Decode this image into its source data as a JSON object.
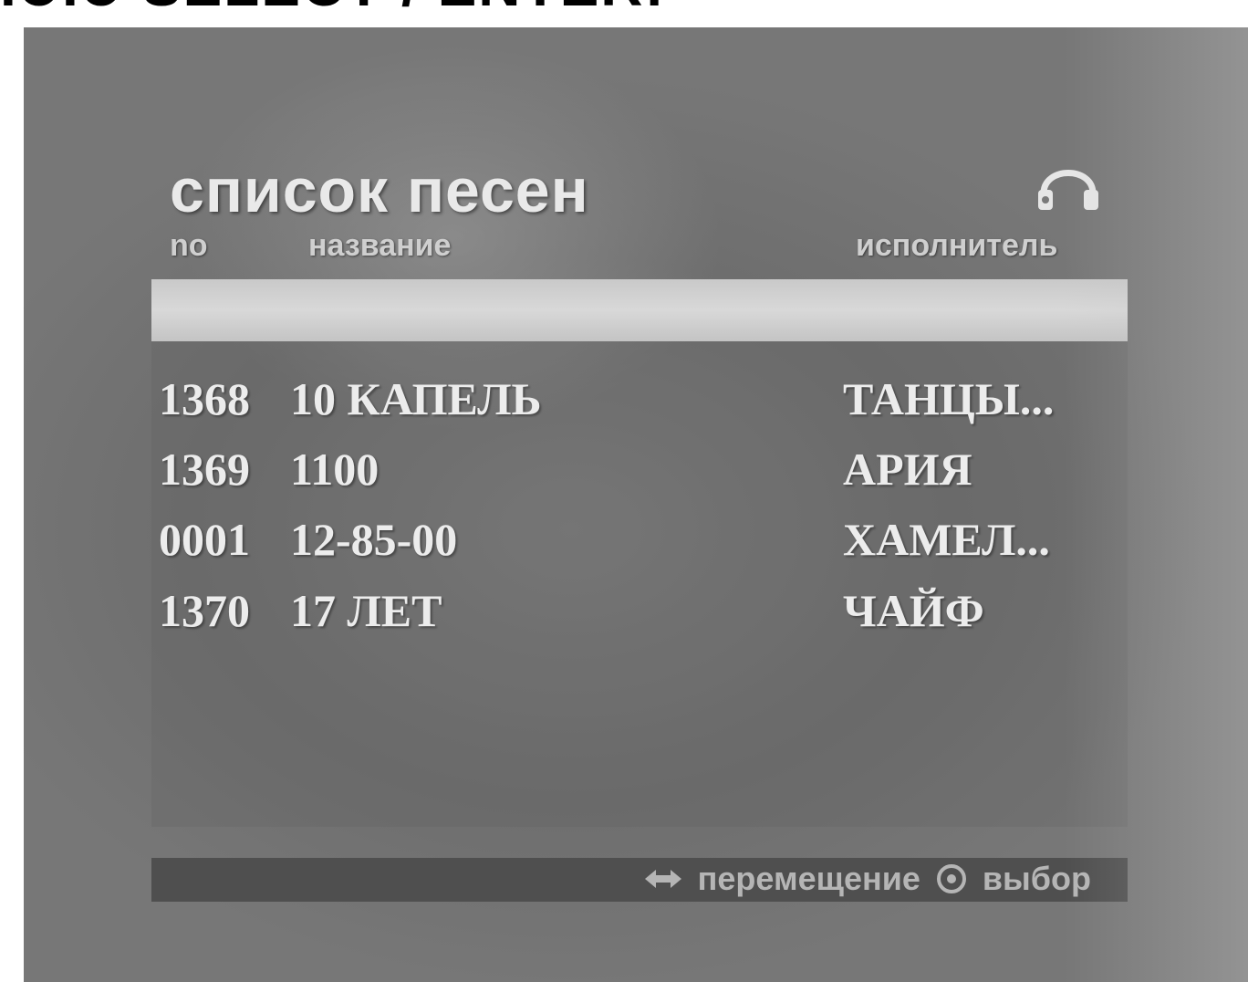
{
  "top_banner": {
    "text": "ЮЮ SELECT / ENTER:"
  },
  "menu": {
    "title": "список песен",
    "columns": {
      "number": "no",
      "name": "название",
      "artist": "исполнитель"
    }
  },
  "songs": [
    {
      "number": "1368",
      "title": "10 КАПЕЛЬ",
      "artist": "ТАНЦЫ..."
    },
    {
      "number": "1369",
      "title": "1100",
      "artist": "АРИЯ"
    },
    {
      "number": "0001",
      "title": "12-85-00",
      "artist": "ХАМЕЛ..."
    },
    {
      "number": "1370",
      "title": "17  ЛЕТ",
      "artist": "ЧАЙФ"
    }
  ],
  "footer": {
    "move_label": "перемещение",
    "select_label": "выбор"
  },
  "icons": {
    "headphone": "headphone-icon",
    "move": "arrows-icon",
    "select": "ok-icon"
  }
}
